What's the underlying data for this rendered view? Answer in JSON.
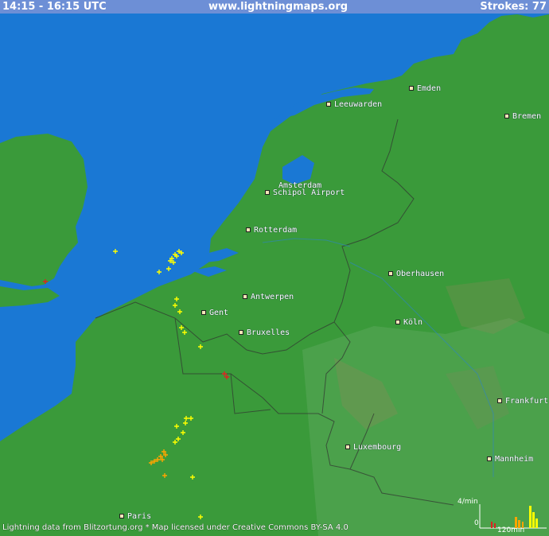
{
  "header": {
    "time_range": "14:15 - 16:15 UTC",
    "site": "www.lightningmaps.org",
    "strokes_label": "Strokes: 77"
  },
  "cities": [
    {
      "name": "Emden"
    },
    {
      "name": "Leeuwarden"
    },
    {
      "name": "Bremen"
    },
    {
      "name": "Amsterdam"
    },
    {
      "name": "Schipol Airport"
    },
    {
      "name": "Rotterdam"
    },
    {
      "name": "Oberhausen"
    },
    {
      "name": "Antwerpen"
    },
    {
      "name": "Gent"
    },
    {
      "name": "Köln"
    },
    {
      "name": "Bruxelles"
    },
    {
      "name": "Frankfurt"
    },
    {
      "name": "Luxembourg"
    },
    {
      "name": "Mannheim"
    },
    {
      "name": "Paris"
    }
  ],
  "footer": {
    "credit": "Lightning data from Blitzortung.org  *  Map licensed under Creative Commons BY-SA 4.0"
  },
  "histogram": {
    "rate_label": "4/min",
    "zero_label": "0",
    "time_label": "120min"
  },
  "colors": {
    "sea": "#1a78d4",
    "land": "#3a9a3a",
    "header_bg": "#6d8fd6",
    "stroke_recent": "#ffff00",
    "stroke_mid": "#ffa500",
    "stroke_old": "#dd2222"
  }
}
